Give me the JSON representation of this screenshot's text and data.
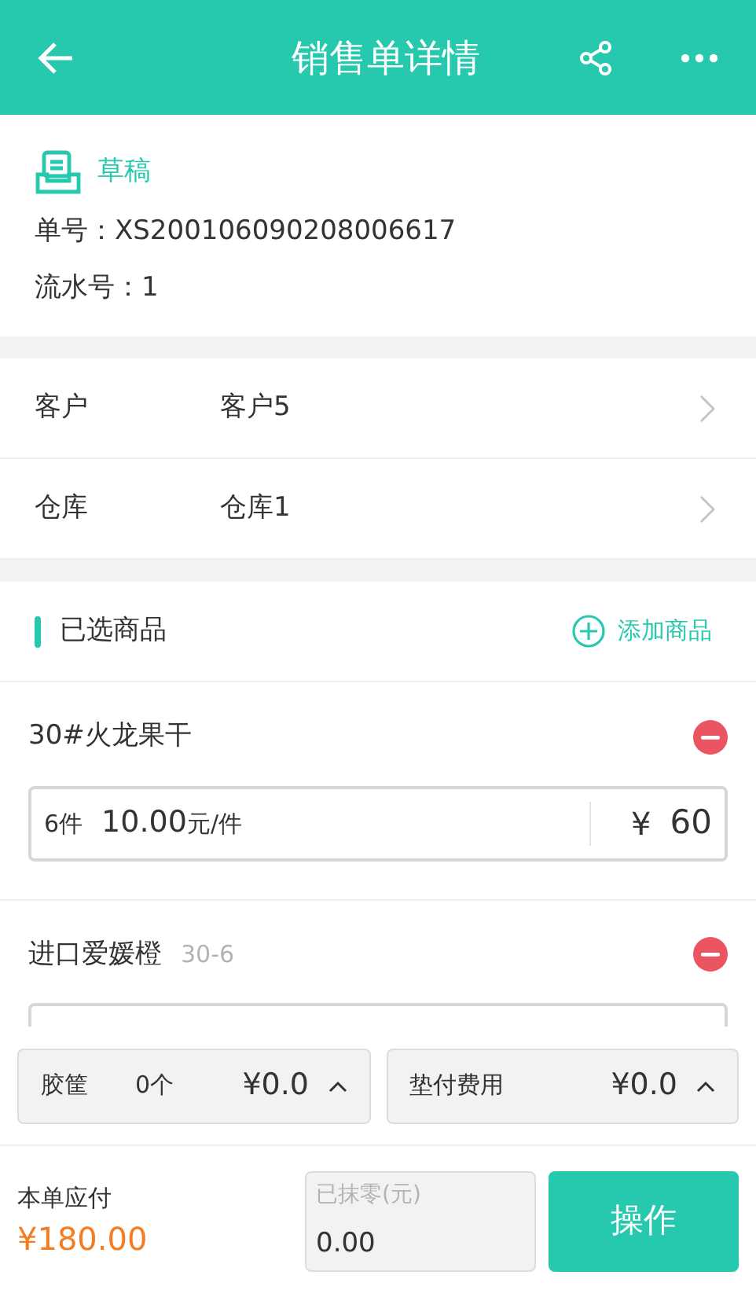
{
  "header": {
    "title": "销售单详情"
  },
  "status": {
    "label": "草稿"
  },
  "info": [
    {
      "label": "单号：",
      "value": "XS200106090208006617"
    },
    {
      "label": "流水号：",
      "value": "1"
    }
  ],
  "fields": [
    {
      "label": "客户",
      "value": "客户5"
    },
    {
      "label": "仓库",
      "value": "仓库1"
    }
  ],
  "goods_section": {
    "title": "已选商品",
    "add_label": "添加商品"
  },
  "products": [
    {
      "name": "30#火龙果干",
      "qty": "6件",
      "price": "10.00",
      "unit": "元/件",
      "currency": "¥",
      "amount": "60"
    },
    {
      "name": "进口爱媛橙",
      "spec": "30-6"
    }
  ],
  "chips": [
    {
      "label": "胶筐",
      "count": "0个",
      "amount": "¥0.0"
    },
    {
      "label": "垫付费用",
      "amount": "¥0.0"
    }
  ],
  "footer": {
    "total_label": "本单应付",
    "total": "¥180.00",
    "discount_placeholder": "已抹零(元)",
    "discount_value": "0.00",
    "action": "操作"
  }
}
